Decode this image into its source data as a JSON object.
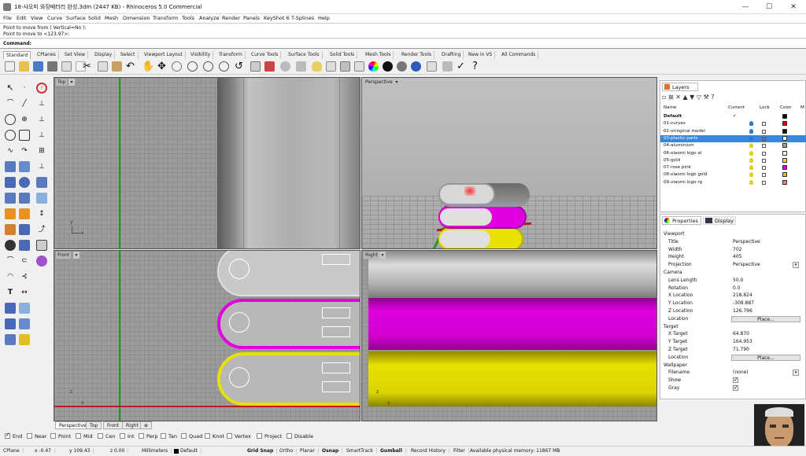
{
  "window": {
    "title": "18-샤오미 와장배터리 완성.3dm (2447 KB) - Rhinoceros 5.0 Commercial",
    "minimize": "—",
    "maximize": "☐",
    "close": "✕"
  },
  "menu": [
    "File",
    "Edit",
    "View",
    "Curve",
    "Surface",
    "Solid",
    "Mesh",
    "Dimension",
    "Transform",
    "Tools",
    "Analyze",
    "Render",
    "Panels",
    "KeyShot 6",
    "T-Splines",
    "Help"
  ],
  "command_history": [
    "Point to move from ( Vertical=No ):",
    "Point to move to <123.97>:"
  ],
  "command": {
    "label": "Command:",
    "value": ""
  },
  "tabs": [
    "Standard",
    "CPlanes",
    "Set View",
    "Display",
    "Select",
    "Viewport Layout",
    "Visibility",
    "Transform",
    "Curve Tools",
    "Surface Tools",
    "Solid Tools",
    "Mesh Tools",
    "Render Tools",
    "Drafting",
    "New in V5",
    "All Commands"
  ],
  "viewports": {
    "top": "Top",
    "perspective": "Perspective",
    "front": "Front",
    "right": "Right"
  },
  "viewport_tabs": [
    "Perspective",
    "Top",
    "Front",
    "Right",
    "⊕"
  ],
  "layers": {
    "title": "Layers",
    "headers": {
      "name": "Name",
      "current": "Current",
      "lock": "Lock",
      "color": "Color",
      "m": "M"
    },
    "rows": [
      {
        "name": "Default",
        "current": "✓",
        "color": "#000000",
        "bold": true
      },
      {
        "name": "01-curves",
        "color": "#cc0000"
      },
      {
        "name": "02-oringinal model",
        "color": "#111111"
      },
      {
        "name": "03-plastic parts",
        "color": "#ffffff",
        "selected": true
      },
      {
        "name": "04-aluminium",
        "color": "#a0a0a0"
      },
      {
        "name": "06-xiaomi logo al",
        "color": "#ffffff"
      },
      {
        "name": "05-gold",
        "color": "#f0e000"
      },
      {
        "name": "07-rose pink",
        "color": "#e000e0"
      },
      {
        "name": "08-xiaomi logo gold",
        "color": "#e8c000"
      },
      {
        "name": "09-xiaomi logo rg",
        "color": "#f08080"
      }
    ]
  },
  "properties": {
    "tab_properties": "Properties",
    "tab_display": "Display",
    "sections": [
      {
        "title": "Viewport",
        "rows": [
          {
            "k": "Title",
            "v": "Perspective"
          },
          {
            "k": "Width",
            "v": "702"
          },
          {
            "k": "Height",
            "v": "405"
          },
          {
            "k": "Projection",
            "v": "Perspective",
            "select": true
          }
        ]
      },
      {
        "title": "Camera",
        "rows": [
          {
            "k": "Lens Length",
            "v": "50.0"
          },
          {
            "k": "Rotation",
            "v": "0.0"
          },
          {
            "k": "X Location",
            "v": "218.824"
          },
          {
            "k": "Y Location",
            "v": "-308.887"
          },
          {
            "k": "Z Location",
            "v": "126.796"
          },
          {
            "k": "Location",
            "btn": "Place..."
          }
        ]
      },
      {
        "title": "Target",
        "rows": [
          {
            "k": "X Target",
            "v": "64.870"
          },
          {
            "k": "Y Target",
            "v": "164.953"
          },
          {
            "k": "Z Target",
            "v": "71.790"
          },
          {
            "k": "Location",
            "btn": "Place..."
          }
        ]
      },
      {
        "title": "Wallpaper",
        "rows": [
          {
            "k": "Filename",
            "v": "(none)",
            "select": true
          },
          {
            "k": "Show",
            "check": true
          },
          {
            "k": "Gray",
            "check": true
          }
        ]
      }
    ]
  },
  "osnaps": [
    {
      "label": "End",
      "on": true
    },
    {
      "label": "Near",
      "on": false
    },
    {
      "label": "Point",
      "on": false
    },
    {
      "label": "Mid",
      "on": false
    },
    {
      "label": "Cen",
      "on": false
    },
    {
      "label": "Int",
      "on": false
    },
    {
      "label": "Perp",
      "on": false
    },
    {
      "label": "Tan",
      "on": false
    },
    {
      "label": "Quad",
      "on": false
    },
    {
      "label": "Knot",
      "on": false
    },
    {
      "label": "Vertex",
      "on": false
    },
    {
      "label": "Project",
      "on": false
    },
    {
      "label": "Disable",
      "on": false
    }
  ],
  "status": {
    "cplane": "CPlane",
    "x": "x -0.47",
    "y": "y 109.43",
    "z": "z 0.00",
    "units": "Millimeters",
    "layer": "Default",
    "grid_snap": "Grid Snap",
    "ortho": "Ortho",
    "planar": "Planar",
    "osnap": "Osnap",
    "smarttrack": "SmartTrack",
    "gumball": "Gumball",
    "record_history": "Record History",
    "filter": "Filter",
    "memory": "Available physical memory: 11867 MB"
  },
  "axes": {
    "x": "x",
    "y": "y",
    "z": "z"
  },
  "colors": {
    "magenta": "#e000e0",
    "yellow": "#e8e000",
    "gray_part": "#b8b8b8"
  }
}
